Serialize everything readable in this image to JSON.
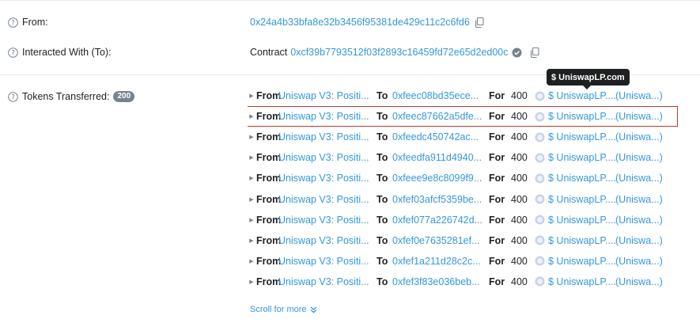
{
  "from": {
    "label": "From:",
    "address": "0x24a4b33bfa8e32b3456f95381de429c11c2c6fd6"
  },
  "interacted": {
    "label": "Interacted With (To):",
    "prefix": "Contract",
    "address": "0xcf39b7793512f03f2893c16459fd72e65d2ed00c"
  },
  "tokens": {
    "label": "Tokens Transferred:",
    "count": "200",
    "tooltip": "$ UniswapLP.com",
    "scroll_more": "Scroll for more",
    "kw_from": "From",
    "kw_to": "To",
    "kw_for": "For",
    "transfers": [
      {
        "from": "Uniswap V3: Positi...",
        "to": "0xfeec08bd35ece...",
        "amount": "400",
        "token": "$ UniswapLP....",
        "token_full": "(Uniswa...)"
      },
      {
        "from": "Uniswap V3: Positi...",
        "to": "0xfeec87662a5dfe...",
        "amount": "400",
        "token": "$ UniswapLP....",
        "token_full": "(Uniswa...)"
      },
      {
        "from": "Uniswap V3: Positi...",
        "to": "0xfeedc450742ac...",
        "amount": "400",
        "token": "$ UniswapLP....",
        "token_full": "(Uniswa...)"
      },
      {
        "from": "Uniswap V3: Positi...",
        "to": "0xfeedfa911d4940...",
        "amount": "400",
        "token": "$ UniswapLP....",
        "token_full": "(Uniswa...)"
      },
      {
        "from": "Uniswap V3: Positi...",
        "to": "0xfeee9e8c8099f9...",
        "amount": "400",
        "token": "$ UniswapLP....",
        "token_full": "(Uniswa...)"
      },
      {
        "from": "Uniswap V3: Positi...",
        "to": "0xfef03afcf5359be...",
        "amount": "400",
        "token": "$ UniswapLP....",
        "token_full": "(Uniswa...)"
      },
      {
        "from": "Uniswap V3: Positi...",
        "to": "0xfef077a226742d...",
        "amount": "400",
        "token": "$ UniswapLP....",
        "token_full": "(Uniswa...)"
      },
      {
        "from": "Uniswap V3: Positi...",
        "to": "0xfef0e7635281ef...",
        "amount": "400",
        "token": "$ UniswapLP....",
        "token_full": "(Uniswa...)"
      },
      {
        "from": "Uniswap V3: Positi...",
        "to": "0xfef1a211d28c2c...",
        "amount": "400",
        "token": "$ UniswapLP....",
        "token_full": "(Uniswa...)"
      },
      {
        "from": "Uniswap V3: Positi...",
        "to": "0xfef3f83e036beb...",
        "amount": "400",
        "token": "$ UniswapLP....",
        "token_full": "(Uniswa...)"
      }
    ]
  },
  "colors": {
    "link": "#3498db",
    "highlight_border": "#c0392b",
    "badge": "#77838f"
  }
}
